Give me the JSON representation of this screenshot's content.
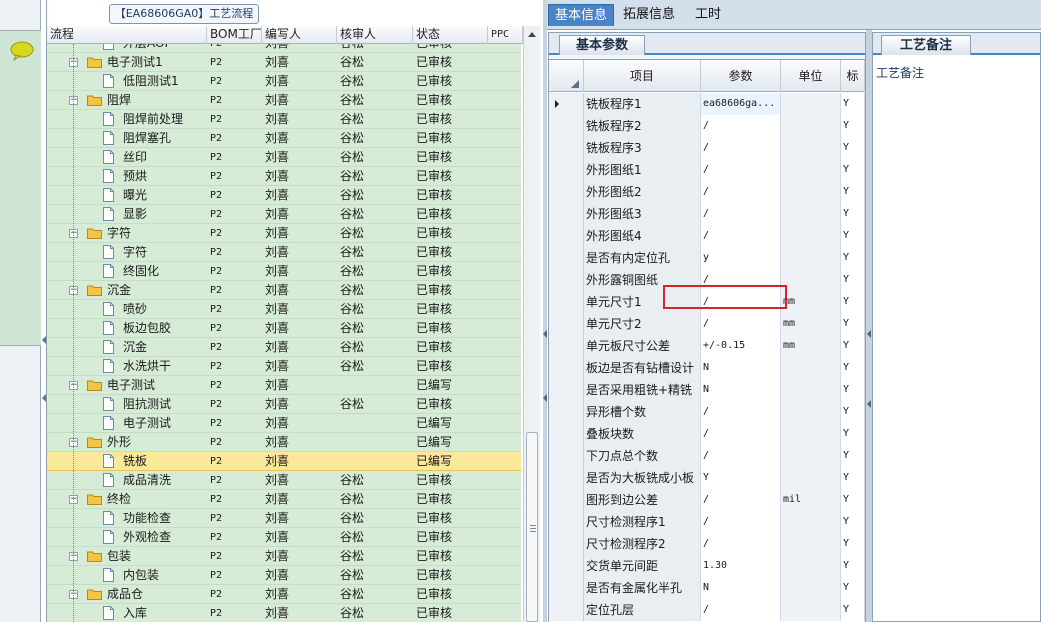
{
  "tree": {
    "title": "【EA68606GA0】工艺流程",
    "columns": [
      "流程",
      "BOM工厂",
      "编写人",
      "核审人",
      "状态",
      "PPC"
    ],
    "rows": [
      {
        "name": "外层AOI",
        "level": 2,
        "bom": "P2",
        "writer": "刘喜",
        "reviewer": "谷松",
        "status": "已审核",
        "partial": true
      },
      {
        "name": "电子测试1",
        "level": 1,
        "bom": "P2",
        "writer": "刘喜",
        "reviewer": "谷松",
        "status": "已审核"
      },
      {
        "name": "低阻测试1",
        "level": 2,
        "bom": "P2",
        "writer": "刘喜",
        "reviewer": "谷松",
        "status": "已审核"
      },
      {
        "name": "阻焊",
        "level": 1,
        "bom": "P2",
        "writer": "刘喜",
        "reviewer": "谷松",
        "status": "已审核"
      },
      {
        "name": "阻焊前处理",
        "level": 2,
        "bom": "P2",
        "writer": "刘喜",
        "reviewer": "谷松",
        "status": "已审核"
      },
      {
        "name": "阻焊塞孔",
        "level": 2,
        "bom": "P2",
        "writer": "刘喜",
        "reviewer": "谷松",
        "status": "已审核"
      },
      {
        "name": "丝印",
        "level": 2,
        "bom": "P2",
        "writer": "刘喜",
        "reviewer": "谷松",
        "status": "已审核"
      },
      {
        "name": "预烘",
        "level": 2,
        "bom": "P2",
        "writer": "刘喜",
        "reviewer": "谷松",
        "status": "已审核"
      },
      {
        "name": "曝光",
        "level": 2,
        "bom": "P2",
        "writer": "刘喜",
        "reviewer": "谷松",
        "status": "已审核"
      },
      {
        "name": "显影",
        "level": 2,
        "bom": "P2",
        "writer": "刘喜",
        "reviewer": "谷松",
        "status": "已审核"
      },
      {
        "name": "字符",
        "level": 1,
        "bom": "P2",
        "writer": "刘喜",
        "reviewer": "谷松",
        "status": "已审核"
      },
      {
        "name": "字符",
        "level": 2,
        "bom": "P2",
        "writer": "刘喜",
        "reviewer": "谷松",
        "status": "已审核"
      },
      {
        "name": "终固化",
        "level": 2,
        "bom": "P2",
        "writer": "刘喜",
        "reviewer": "谷松",
        "status": "已审核"
      },
      {
        "name": "沉金",
        "level": 1,
        "bom": "P2",
        "writer": "刘喜",
        "reviewer": "谷松",
        "status": "已审核"
      },
      {
        "name": "喷砂",
        "level": 2,
        "bom": "P2",
        "writer": "刘喜",
        "reviewer": "谷松",
        "status": "已审核"
      },
      {
        "name": "板边包胶",
        "level": 2,
        "bom": "P2",
        "writer": "刘喜",
        "reviewer": "谷松",
        "status": "已审核"
      },
      {
        "name": "沉金",
        "level": 2,
        "bom": "P2",
        "writer": "刘喜",
        "reviewer": "谷松",
        "status": "已审核"
      },
      {
        "name": "水洗烘干",
        "level": 2,
        "bom": "P2",
        "writer": "刘喜",
        "reviewer": "谷松",
        "status": "已审核"
      },
      {
        "name": "电子测试",
        "level": 1,
        "bom": "P2",
        "writer": "刘喜",
        "reviewer": "",
        "status": "已编写"
      },
      {
        "name": "阻抗测试",
        "level": 2,
        "bom": "P2",
        "writer": "刘喜",
        "reviewer": "谷松",
        "status": "已审核"
      },
      {
        "name": "电子测试",
        "level": 2,
        "bom": "P2",
        "writer": "刘喜",
        "reviewer": "",
        "status": "已编写"
      },
      {
        "name": "外形",
        "level": 1,
        "bom": "P2",
        "writer": "刘喜",
        "reviewer": "",
        "status": "已编写"
      },
      {
        "name": "铣板",
        "level": 2,
        "bom": "P2",
        "writer": "刘喜",
        "reviewer": "",
        "status": "已编写",
        "selected": true
      },
      {
        "name": "成品清洗",
        "level": 2,
        "bom": "P2",
        "writer": "刘喜",
        "reviewer": "谷松",
        "status": "已审核"
      },
      {
        "name": "终检",
        "level": 1,
        "bom": "P2",
        "writer": "刘喜",
        "reviewer": "谷松",
        "status": "已审核"
      },
      {
        "name": "功能检查",
        "level": 2,
        "bom": "P2",
        "writer": "刘喜",
        "reviewer": "谷松",
        "status": "已审核"
      },
      {
        "name": "外观检查",
        "level": 2,
        "bom": "P2",
        "writer": "刘喜",
        "reviewer": "谷松",
        "status": "已审核"
      },
      {
        "name": "包装",
        "level": 1,
        "bom": "P2",
        "writer": "刘喜",
        "reviewer": "谷松",
        "status": "已审核"
      },
      {
        "name": "内包装",
        "level": 2,
        "bom": "P2",
        "writer": "刘喜",
        "reviewer": "谷松",
        "status": "已审核"
      },
      {
        "name": "成品仓",
        "level": 1,
        "bom": "P2",
        "writer": "刘喜",
        "reviewer": "谷松",
        "status": "已审核"
      },
      {
        "name": "入库",
        "level": 2,
        "bom": "P2",
        "writer": "刘喜",
        "reviewer": "谷松",
        "status": "已审核",
        "partial": true
      }
    ]
  },
  "tabs": [
    "基本信息",
    "拓展信息",
    "工时"
  ],
  "params": {
    "tab_label": "基本参数",
    "columns": [
      "项目",
      "参数",
      "单位",
      "标"
    ],
    "rows": [
      {
        "item": "铣板程序1",
        "param": "ea68606ga...",
        "unit": "",
        "flag": "Y",
        "active": true
      },
      {
        "item": "铣板程序2",
        "param": "/",
        "unit": "",
        "flag": "Y"
      },
      {
        "item": "铣板程序3",
        "param": "/",
        "unit": "",
        "flag": "Y"
      },
      {
        "item": "外形图纸1",
        "param": "/",
        "unit": "",
        "flag": "Y"
      },
      {
        "item": "外形图纸2",
        "param": "/",
        "unit": "",
        "flag": "Y"
      },
      {
        "item": "外形图纸3",
        "param": "/",
        "unit": "",
        "flag": "Y"
      },
      {
        "item": "外形图纸4",
        "param": "/",
        "unit": "",
        "flag": "Y"
      },
      {
        "item": "是否有内定位孔",
        "param": "y",
        "unit": "",
        "flag": "Y"
      },
      {
        "item": "外形露铜图纸",
        "param": "/",
        "unit": "",
        "flag": "Y"
      },
      {
        "item": "单元尺寸1",
        "param": "/",
        "unit": "mm",
        "flag": "Y"
      },
      {
        "item": "单元尺寸2",
        "param": "/",
        "unit": "mm",
        "flag": "Y"
      },
      {
        "item": "单元板尺寸公差",
        "param": "+/-0.15",
        "unit": "mm",
        "flag": "Y"
      },
      {
        "item": "板边是否有钻槽设计",
        "param": "N",
        "unit": "",
        "flag": "Y"
      },
      {
        "item": "是否采用粗铣+精铣",
        "param": "N",
        "unit": "",
        "flag": "Y"
      },
      {
        "item": "异形槽个数",
        "param": "/",
        "unit": "",
        "flag": "Y"
      },
      {
        "item": "叠板块数",
        "param": "/",
        "unit": "",
        "flag": "Y"
      },
      {
        "item": "下刀点总个数",
        "param": "/",
        "unit": "",
        "flag": "Y"
      },
      {
        "item": "是否为大板铣成小板",
        "param": "Y",
        "unit": "",
        "flag": "Y"
      },
      {
        "item": "图形到边公差",
        "param": "/",
        "unit": "mil",
        "flag": "Y"
      },
      {
        "item": "尺寸检测程序1",
        "param": "/",
        "unit": "",
        "flag": "Y"
      },
      {
        "item": "尺寸检测程序2",
        "param": "/",
        "unit": "",
        "flag": "Y"
      },
      {
        "item": "交货单元间距",
        "param": "1.30",
        "unit": "",
        "flag": "Y"
      },
      {
        "item": "是否有金属化半孔",
        "param": "N",
        "unit": "",
        "flag": "Y"
      },
      {
        "item": "定位孔层",
        "param": "/",
        "unit": "",
        "flag": "Y"
      }
    ]
  },
  "remark": {
    "tab_label": "工艺备注",
    "label": "工艺备注"
  }
}
